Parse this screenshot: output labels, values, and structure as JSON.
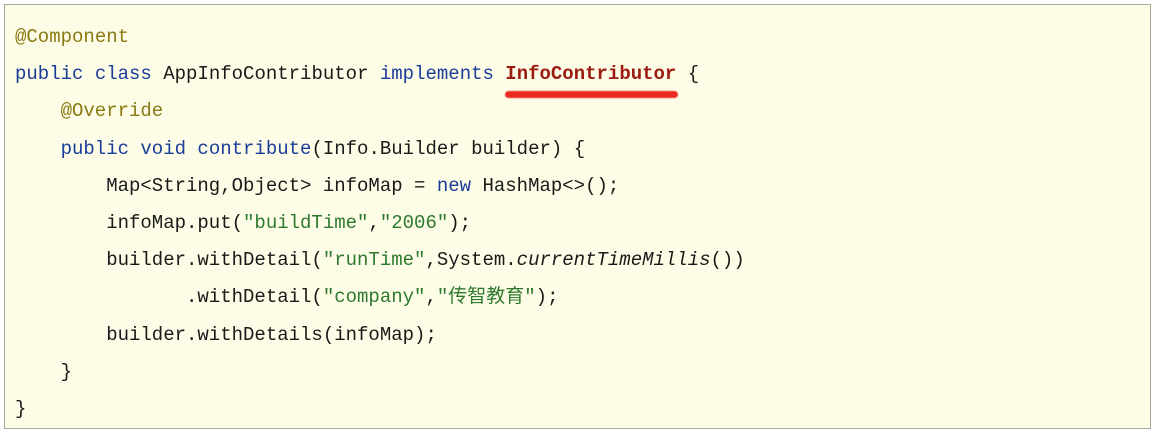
{
  "code": {
    "colors": {
      "keyword": "#1b3d9a",
      "annotation": "#8a7a12",
      "string": "#2e7a2e",
      "highlight": "#9c1b10",
      "underline": "#e8140c",
      "background": "#fdfce6"
    },
    "lines": [
      {
        "indent": 0,
        "tokens": [
          {
            "t": "@Component",
            "c": "ann"
          }
        ]
      },
      {
        "indent": 0,
        "tokens": [
          {
            "t": "public class ",
            "c": "kw"
          },
          {
            "t": "AppInfoContributor "
          },
          {
            "t": "implements ",
            "c": "kw"
          },
          {
            "t": "InfoContributor",
            "c": "type-hl"
          },
          {
            "t": " {"
          }
        ]
      },
      {
        "indent": 4,
        "tokens": [
          {
            "t": "@Override",
            "c": "ann"
          }
        ]
      },
      {
        "indent": 4,
        "tokens": [
          {
            "t": "public void ",
            "c": "kw"
          },
          {
            "t": "contribute",
            "c": "kw"
          },
          {
            "t": "(Info.Builder builder) {"
          }
        ]
      },
      {
        "indent": 8,
        "tokens": [
          {
            "t": "Map<String,Object> infoMap = "
          },
          {
            "t": "new",
            "c": "kw"
          },
          {
            "t": " HashMap<>();"
          }
        ]
      },
      {
        "indent": 8,
        "tokens": [
          {
            "t": "infoMap.put("
          },
          {
            "t": "\"buildTime\"",
            "c": "str"
          },
          {
            "t": ","
          },
          {
            "t": "\"2006\"",
            "c": "str"
          },
          {
            "t": ");"
          }
        ]
      },
      {
        "indent": 8,
        "tokens": [
          {
            "t": "builder.withDetail("
          },
          {
            "t": "\"runTime\"",
            "c": "str"
          },
          {
            "t": ",System."
          },
          {
            "t": "currentTimeMillis",
            "c": "italic"
          },
          {
            "t": "())"
          }
        ]
      },
      {
        "indent": 15,
        "tokens": [
          {
            "t": ".withDetail("
          },
          {
            "t": "\"company\"",
            "c": "str"
          },
          {
            "t": ","
          },
          {
            "t": "\"传智教育\"",
            "c": "str"
          },
          {
            "t": ");"
          }
        ]
      },
      {
        "indent": 8,
        "tokens": [
          {
            "t": "builder.withDetails(infoMap);"
          }
        ]
      },
      {
        "indent": 4,
        "tokens": [
          {
            "t": "}"
          }
        ]
      },
      {
        "indent": 0,
        "tokens": [
          {
            "t": "}"
          }
        ]
      }
    ]
  }
}
